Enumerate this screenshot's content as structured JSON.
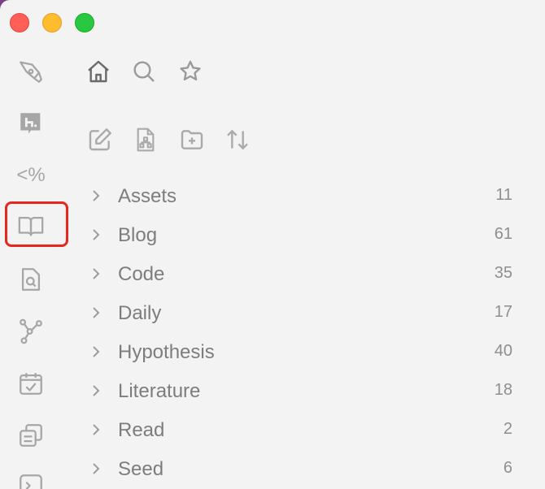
{
  "window": {
    "traffic_lights": [
      "close",
      "minimize",
      "maximize"
    ]
  },
  "ribbon": {
    "items": [
      {
        "icon": "pen-nib-icon"
      },
      {
        "icon": "h-dot-logo-icon"
      },
      {
        "text": "<%"
      },
      {
        "icon": "open-book-icon",
        "highlighted": true
      },
      {
        "icon": "file-search-icon"
      },
      {
        "icon": "graph-icon"
      },
      {
        "icon": "calendar-check-icon"
      },
      {
        "icon": "copy-pages-icon"
      },
      {
        "icon": "terminal-icon"
      }
    ]
  },
  "nav_tabs": [
    {
      "icon": "home-icon",
      "active": true
    },
    {
      "icon": "search-icon"
    },
    {
      "icon": "star-icon"
    }
  ],
  "toolbar": [
    {
      "icon": "new-note-icon"
    },
    {
      "icon": "new-canvas-icon"
    },
    {
      "icon": "new-folder-icon"
    },
    {
      "icon": "sort-icon"
    }
  ],
  "folders": [
    {
      "name": "Assets",
      "count": "11"
    },
    {
      "name": "Blog",
      "count": "61"
    },
    {
      "name": "Code",
      "count": "35"
    },
    {
      "name": "Daily",
      "count": "17"
    },
    {
      "name": "Hypothesis",
      "count": "40"
    },
    {
      "name": "Literature",
      "count": "18"
    },
    {
      "name": "Read",
      "count": "2"
    },
    {
      "name": "Seed",
      "count": "6"
    }
  ],
  "colors": {
    "highlight": "#e8261c",
    "background": "#f3f3f3",
    "text": "#7d7d7d"
  }
}
